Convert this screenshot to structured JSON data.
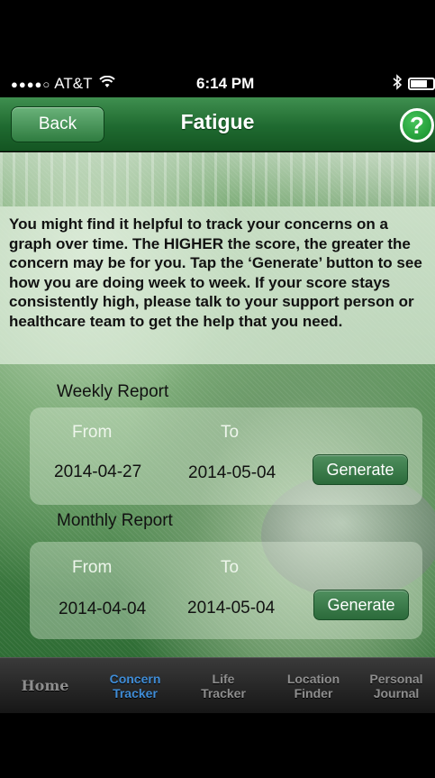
{
  "status_bar": {
    "signal": "●●●●○",
    "carrier": "AT&T",
    "time": "6:14 PM"
  },
  "nav": {
    "back_label": "Back",
    "title": "Fatigue",
    "help_label": "?"
  },
  "intro": {
    "text": "You might find it helpful to track your concerns on a graph over time. The HIGHER the score, the greater the concern may be for you. Tap the ‘Generate’ button to see how you are doing week to week. If your score stays consistently high, please talk to your support person or healthcare team to get the help that you need."
  },
  "weekly": {
    "label": "Weekly Report",
    "from_label": "From",
    "to_label": "To",
    "from_date": "2014-04-27",
    "to_date": "2014-05-04",
    "generate_label": "Generate"
  },
  "monthly": {
    "label": "Monthly Report",
    "from_label": "From",
    "to_label": "To",
    "from_date": "2014-04-04",
    "to_date": "2014-05-04",
    "generate_label": "Generate"
  },
  "tabs": [
    {
      "line1": "Home",
      "line2": ""
    },
    {
      "line1": "Concern",
      "line2": "Tracker"
    },
    {
      "line1": "Life",
      "line2": "Tracker"
    },
    {
      "line1": "Location",
      "line2": "Finder"
    },
    {
      "line1": "Personal",
      "line2": "Journal"
    }
  ],
  "colors": {
    "nav_green": "#1f6a30",
    "active_tab": "#3f8cd6",
    "inactive_tab": "#8e8e8e"
  }
}
